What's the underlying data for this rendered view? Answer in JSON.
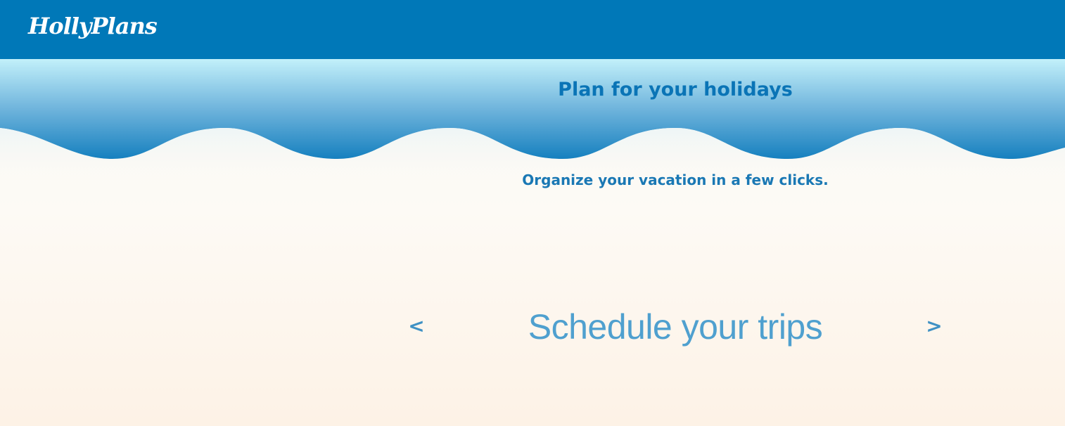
{
  "header": {
    "logo_text": "HollyPlans"
  },
  "hero": {
    "headline": "Plan for your holidays",
    "subline": "Organize your vacation in a few clicks."
  },
  "slider": {
    "prev_label": "<",
    "next_label": ">",
    "current_slide": "Schedule your trips"
  },
  "colors": {
    "header_bg": "#0078b8",
    "wave_top": "#bdeef8",
    "wave_bottom": "#1a82c0",
    "headline": "#0a74b6",
    "slide_text": "#4fa0cf",
    "page_bg": "#fdf5ec"
  }
}
